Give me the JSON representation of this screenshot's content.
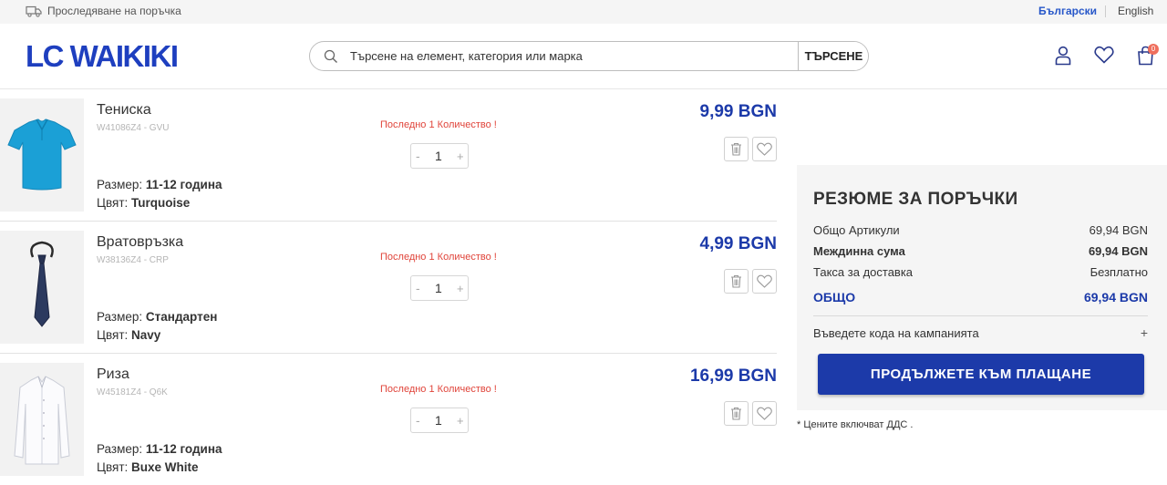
{
  "topbar": {
    "track_icon": "truck-icon",
    "track_label": "Проследяване на поръчка",
    "lang_bg": "Български",
    "lang_en": "English"
  },
  "header": {
    "logo": "LC WAIKIKI",
    "search": {
      "placeholder": "Търсене на елемент, категория или марка",
      "button": "ТЪРСЕНЕ"
    },
    "icons": [
      "user-icon",
      "heart-icon",
      "shopping-bag-icon"
    ],
    "cart_count": "0"
  },
  "cart": {
    "items": [
      {
        "name": "Тениска",
        "sku": "W41086Z4 - GVU",
        "stock_note": "Последно 1 Количество !",
        "quantity": "1",
        "qty_minus": "-",
        "qty_plus": "+",
        "price": "9,99 BGN",
        "size_label": "Размер:",
        "size": "11-12 година",
        "color_label": "Цвят:",
        "color": "Turquoise",
        "image": "turquoise-polo-shirt"
      },
      {
        "name": "Вратовръзка",
        "sku": "W38136Z4 - CRP",
        "stock_note": "Последно 1 Количество !",
        "quantity": "1",
        "qty_minus": "-",
        "qty_plus": "+",
        "price": "4,99 BGN",
        "size_label": "Размер:",
        "size": "Стандартен",
        "color_label": "Цвят:",
        "color": "Navy",
        "image": "navy-tie"
      },
      {
        "name": "Риза",
        "sku": "W45181Z4 - Q6K",
        "stock_note": "Последно 1 Количество !",
        "quantity": "1",
        "qty_minus": "-",
        "qty_plus": "+",
        "price": "16,99 BGN",
        "size_label": "Размер:",
        "size": "11-12 година",
        "color_label": "Цвят:",
        "color": "Buxe White",
        "image": "white-shirt"
      }
    ]
  },
  "summary": {
    "title": "РЕЗЮМЕ ЗА ПОРЪЧКИ",
    "rows": [
      {
        "label": "Общо Артикули",
        "value": "69,94 BGN"
      },
      {
        "label": "Междинна сума",
        "value": "69,94 BGN"
      },
      {
        "label": "Такса за доставка",
        "value": "Безплатно"
      }
    ],
    "total_label": "ОБЩО",
    "total_value": "69,94 BGN",
    "promo_label": "Въведете кода на кампанията",
    "promo_plus": "+",
    "checkout": "ПРОДЪЛЖЕТЕ КЪМ ПЛАЩАНЕ",
    "vat_note": "* Цените включват ДДС ."
  },
  "colors": {
    "brand": "#1c3aa9",
    "stock_warning": "#e0443a",
    "badge": "#ef6f5d"
  }
}
